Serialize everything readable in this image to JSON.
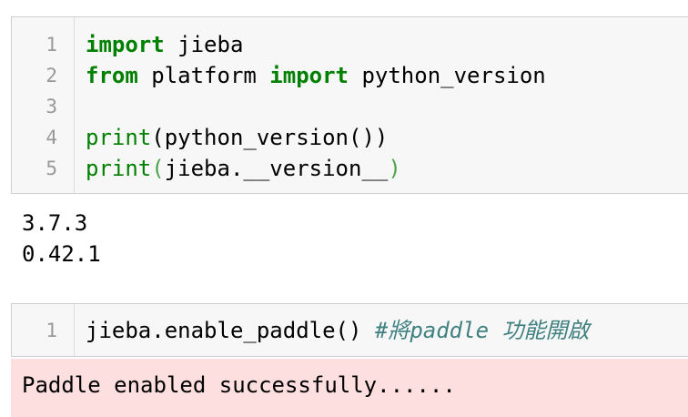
{
  "cell1": {
    "line_numbers": [
      "1",
      "2",
      "3",
      "4",
      "5"
    ],
    "lines": {
      "l1": {
        "kw": "import",
        "rest": " jieba"
      },
      "l2": {
        "kw1": "from",
        "mid": " platform ",
        "kw2": "import",
        "rest": " python_version"
      },
      "l4": {
        "fn": "print",
        "rest": "(python_version())"
      },
      "l5": {
        "fn": "print",
        "open": "(",
        "mid": "jieba.__version__",
        "close": ")"
      }
    },
    "output": [
      "3.7.3",
      "0.42.1"
    ]
  },
  "cell2": {
    "line_numbers": [
      "1"
    ],
    "code": "jieba.enable_paddle() ",
    "comment": "#將paddle 功能開啟",
    "stderr": "Paddle enabled successfully......"
  }
}
